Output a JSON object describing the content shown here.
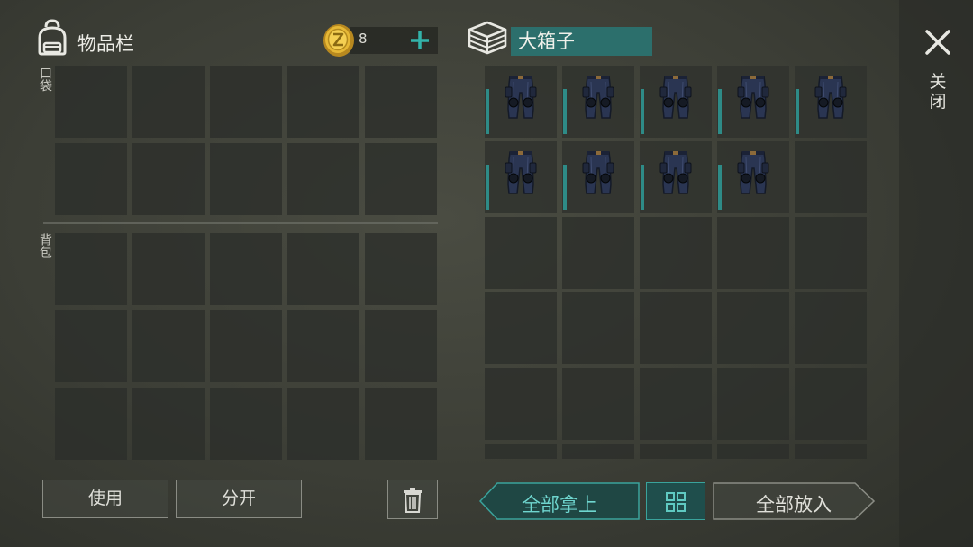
{
  "inventory": {
    "title": "物品栏",
    "coins": "8",
    "pocket_label": "口袋",
    "backpack_label": "背包"
  },
  "container": {
    "name": "大箱子",
    "items": [
      {
        "slot": 1,
        "icon": "pants-icon"
      },
      {
        "slot": 2,
        "icon": "pants-icon"
      },
      {
        "slot": 3,
        "icon": "pants-icon"
      },
      {
        "slot": 4,
        "icon": "pants-icon"
      },
      {
        "slot": 5,
        "icon": "pants-icon"
      },
      {
        "slot": 6,
        "icon": "pants-icon"
      },
      {
        "slot": 7,
        "icon": "pants-icon"
      },
      {
        "slot": 8,
        "icon": "pants-icon"
      },
      {
        "slot": 9,
        "icon": "pants-icon"
      }
    ]
  },
  "buttons": {
    "use": "使用",
    "split": "分开",
    "take_all": "全部拿上",
    "put_all": "全部放入",
    "close": "关闭"
  },
  "colors": {
    "accent": "#2e8b87",
    "take_all_text": "#6fd6cf"
  }
}
